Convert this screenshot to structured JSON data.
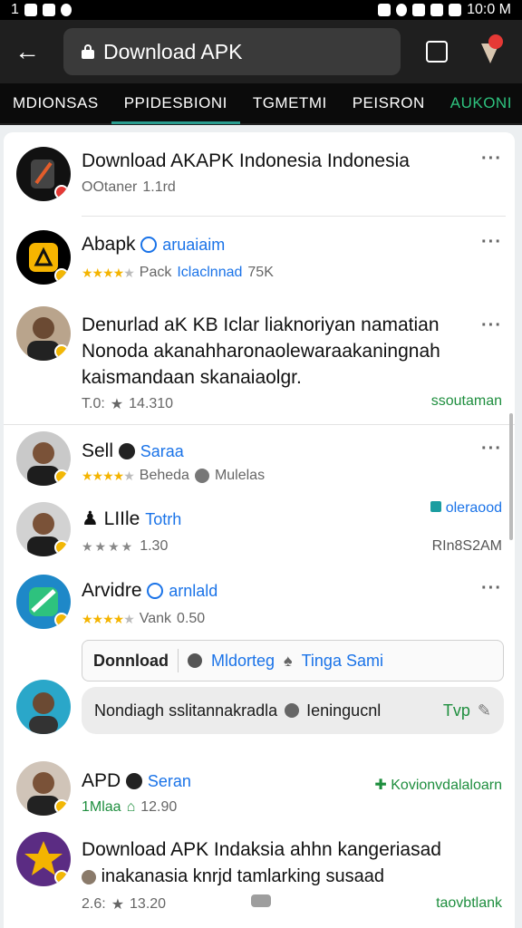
{
  "status": {
    "left": "1",
    "time": "10:0 M"
  },
  "urlbar": {
    "url": "Download APK",
    "tabs_count": ""
  },
  "navtabs": [
    "MDIONSAS",
    "PPIDESBIONI",
    "TGMETMI",
    "PEISRON",
    "AUKONI"
  ],
  "items": [
    {
      "title": "Download AKAPK Indonesia Indonesia",
      "sub1": "OOtaner",
      "sub2": "1.1rd"
    },
    {
      "title": "Abapk",
      "verified": "aruaiaim",
      "rating_label": "Pack",
      "extra": "Iclaclnnad",
      "count": "75K"
    },
    {
      "title": "Denurlad aK KB Iclar liaknoriyan namatian Nonoda akanahharonaolewaraakaningnah kaismandaan skanaiaolgr.",
      "rating": "T.0:",
      "count": "14.310",
      "right": "ssoutaman"
    },
    {
      "title": "Sell",
      "verified": "Saraa",
      "extra": "Beheda",
      "extra2": "Mulelas"
    },
    {
      "title": "LIIle",
      "verified": "Totrh",
      "right_top": "oleraood",
      "count": "1.30",
      "right": "RIn8S2AM"
    },
    {
      "title": "Arvidre",
      "verified": "arnlald",
      "extra": "Vank",
      "count": "0.50"
    },
    {
      "download_bar": {
        "label": "Donnload",
        "opt1": "Mldorteg",
        "opt2": "Tinga Sami"
      }
    },
    {
      "comment": {
        "text": "Nondiagh sslitannakradla",
        "text2": "Ieningucnl",
        "action": "Tvp"
      }
    },
    {
      "title": "APD",
      "verified": "Seran",
      "sub": "1Mlaa",
      "count": "12.90",
      "right_top": "Kovionvdalaloarn"
    },
    {
      "title": "Download APK Indaksia ahhn kangeriasad",
      "line2": "inakanasia knrjd tamlarking susaad",
      "rating": "2.6:",
      "count": "13.20",
      "right": "taovbtlank"
    }
  ],
  "colors": {
    "accent_green": "#1e8e3e",
    "accent_blue": "#1a73e8",
    "star": "#f4b400"
  }
}
